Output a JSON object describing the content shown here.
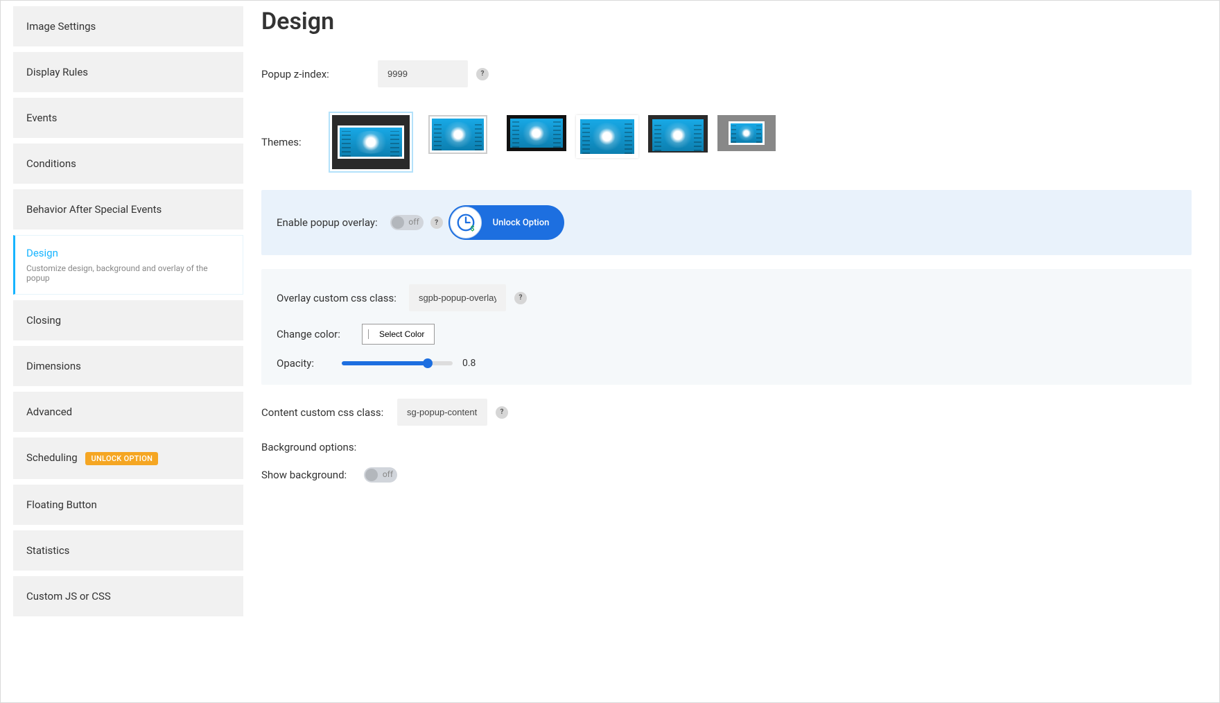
{
  "sidebar": {
    "items": [
      {
        "label": "Image Settings"
      },
      {
        "label": "Display Rules"
      },
      {
        "label": "Events"
      },
      {
        "label": "Conditions"
      },
      {
        "label": "Behavior After Special Events"
      },
      {
        "label": "Design",
        "desc": "Customize design, background and overlay of the popup"
      },
      {
        "label": "Closing"
      },
      {
        "label": "Dimensions"
      },
      {
        "label": "Advanced"
      },
      {
        "label": "Scheduling",
        "badge": "UNLOCK OPTION"
      },
      {
        "label": "Floating Button"
      },
      {
        "label": "Statistics"
      },
      {
        "label": "Custom JS or CSS"
      }
    ]
  },
  "page": {
    "title": "Design",
    "labels": {
      "zindex": "Popup z-index:",
      "themes": "Themes:",
      "enable_overlay": "Enable popup overlay:",
      "unlock_option": "Unlock Option",
      "overlay_css": "Overlay custom css class:",
      "change_color": "Change color:",
      "select_color": "Select Color",
      "opacity": "Opacity:",
      "content_css": "Content custom css class:",
      "bg_options": "Background options:",
      "show_bg": "Show background:",
      "toggle_off": "off"
    },
    "values": {
      "zindex": "9999",
      "overlay_css": "sgpb-popup-overlay",
      "content_css": "sg-popup-content",
      "opacity": "0.8"
    }
  }
}
